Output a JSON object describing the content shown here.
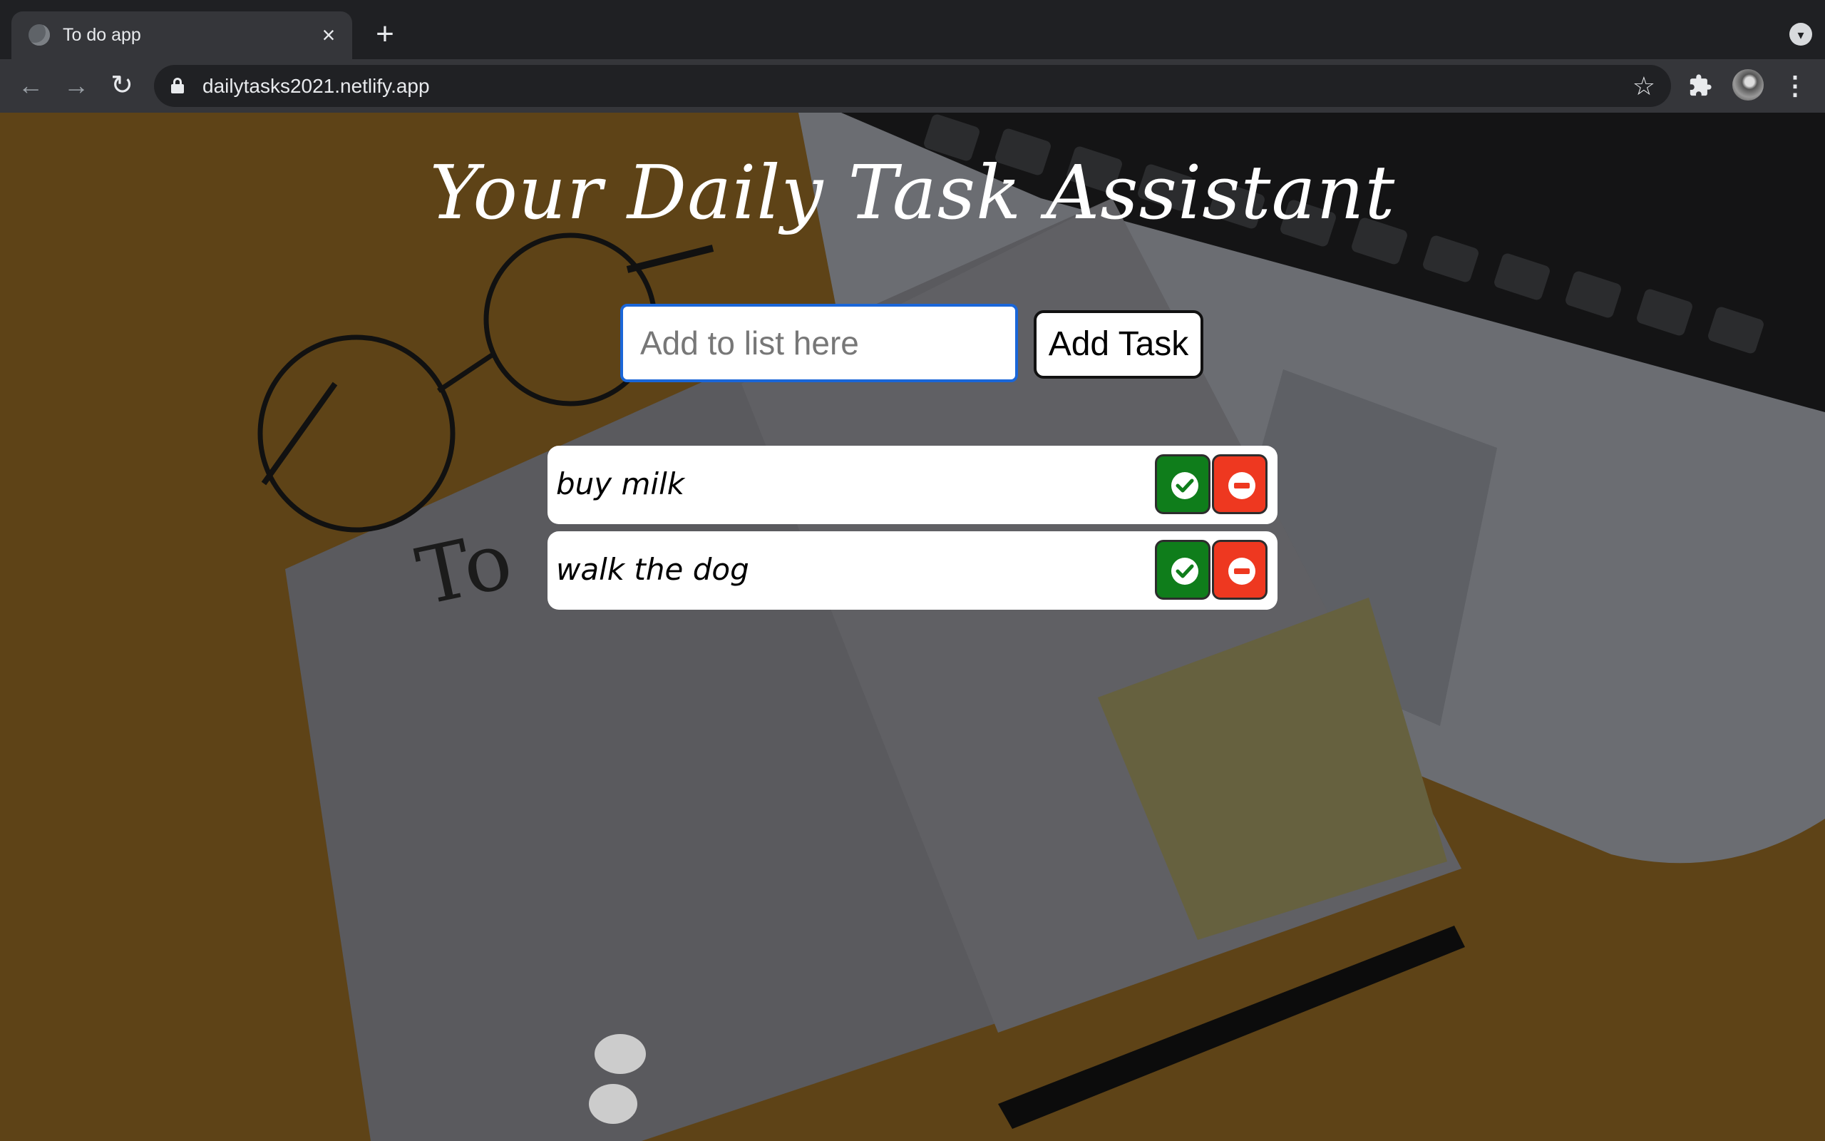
{
  "browser": {
    "tab": {
      "title": "To do app",
      "close_icon": "×",
      "favicon_icon": "globe-icon"
    },
    "new_tab_icon": "+",
    "tab_search_icon": "▾",
    "nav": {
      "back_icon": "←",
      "forward_icon": "→",
      "reload_icon": "↻"
    },
    "address_bar": {
      "url": "dailytasks2021.netlify.app",
      "lock_icon": "lock-icon",
      "bookmark_icon": "☆"
    },
    "extensions_icon": "puzzle-icon",
    "profile_icon": "avatar",
    "menu_icon": "⋮"
  },
  "app": {
    "title": "Your Daily Task Assistant",
    "input": {
      "placeholder": "Add to list here",
      "value": ""
    },
    "add_button_label": "Add Task",
    "tasks": [
      {
        "text": "buy milk",
        "done_icon": "check-icon",
        "delete_icon": "minus-circle-icon"
      },
      {
        "text": "walk the dog",
        "done_icon": "check-icon",
        "delete_icon": "minus-circle-icon"
      }
    ],
    "colors": {
      "done_button": "#0f7d1b",
      "delete_button": "#ee3820",
      "input_focus": "#1a66d8"
    }
  }
}
